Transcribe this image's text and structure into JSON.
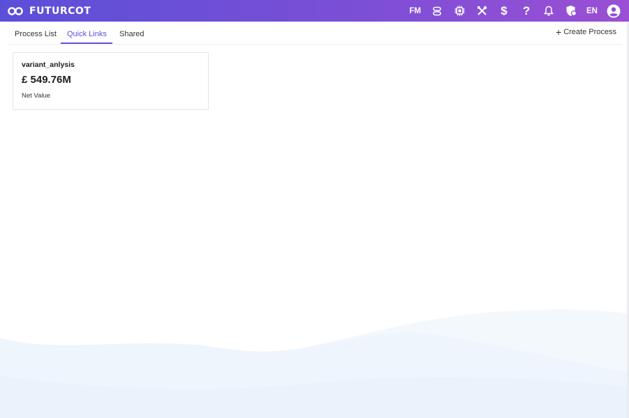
{
  "header": {
    "brand_name": "FUTURCOT",
    "user_initials": "FM",
    "language": "EN",
    "icons": [
      "database-icon",
      "chip-icon",
      "tools-icon",
      "dollar-icon",
      "help-icon",
      "bell-icon",
      "shield-icon",
      "account-icon"
    ]
  },
  "tabs": [
    {
      "label": "Process List"
    },
    {
      "label": "Quick Links",
      "active": true
    },
    {
      "label": "Shared"
    }
  ],
  "actions": {
    "create_label": "Create Process"
  },
  "card": {
    "title": "variant_anlysis",
    "value": "£ 549.76M",
    "label": "Net Value"
  },
  "colors": {
    "header_start": "#5b4fd8",
    "header_end": "#9a4fd4",
    "accent": "#5b4fd8",
    "wave": "#eaf3fb"
  }
}
